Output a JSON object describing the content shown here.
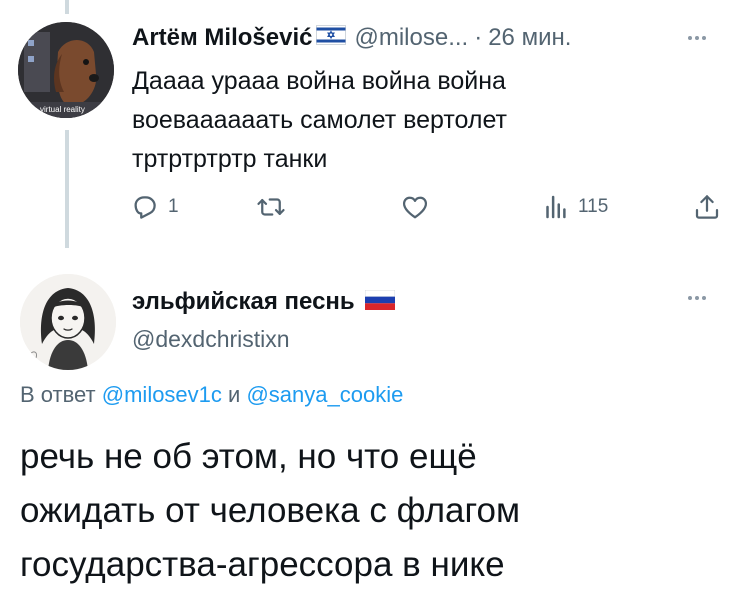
{
  "thread": {
    "parent": {
      "author_name": "Artём Milošević",
      "handle": "@milose...",
      "separator": "·",
      "time": "26 мин.",
      "flag": "israel-flag",
      "avatar_badge": "virtual reality",
      "text_lines": [
        "Дaaaa урааа война война война",
        "воеваааааать самолет вертолет",
        "тртртртртр танки"
      ],
      "actions": {
        "reply_count": "1",
        "retweet_count": "",
        "like_count": "",
        "views_count": "115"
      }
    },
    "reply": {
      "author_name": "эльфийская песнь",
      "flag": "russia-flag",
      "handle": "@dexdchristixn",
      "reply_prefix": "В ответ",
      "reply_mention_1": "@milosev1c",
      "reply_conjunction": "и",
      "reply_mention_2": "@sanya_cookie",
      "text_lines": [
        "речь не об этом, но что ещё",
        "ожидать от человека с флагом",
        "государства-агрессора в нике"
      ]
    }
  },
  "colors": {
    "text_primary": "#0f1419",
    "text_secondary": "#536471",
    "link": "#1d9bf0",
    "thread_line": "#cfd9de"
  }
}
